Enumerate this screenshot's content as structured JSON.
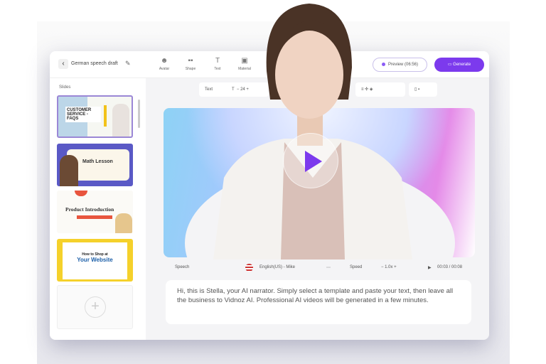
{
  "header": {
    "back_icon": "chevron-left-icon",
    "project_title": "German speech draft",
    "edit_icon": "pencil-icon",
    "tools": [
      {
        "label": "Avatar",
        "icon": "avatar-icon"
      },
      {
        "label": "Shape",
        "icon": "shape-icon"
      },
      {
        "label": "Text",
        "icon": "text-icon"
      },
      {
        "label": "Material",
        "icon": "material-icon"
      }
    ],
    "preview_label": "Preview (06:56)",
    "generate_label": "Generate"
  },
  "sidebar": {
    "label": "Slides",
    "slides": [
      {
        "title": "CUSTOMER SERVICE - FAQS"
      },
      {
        "title": "Math Lesson"
      },
      {
        "title": "Product Introduction"
      },
      {
        "title": "How to Shop at",
        "subtitle": "Your Website"
      }
    ],
    "add_icon": "plus-icon"
  },
  "format_bar": {
    "text_label": "Text",
    "font_size": "24"
  },
  "speech": {
    "label": "Speech",
    "voice": "English(US) - Mike",
    "speed_label": "Speed",
    "speed": "1.0x",
    "time": "00:03 / 00:08"
  },
  "script_text": "Hi, this is Stella, your AI narrator. Simply select a template and paste your text, then leave all the business to Vidnoz AI. Professional AI videos will be generated in a few minutes.",
  "colors": {
    "accent": "#7c3aed"
  }
}
